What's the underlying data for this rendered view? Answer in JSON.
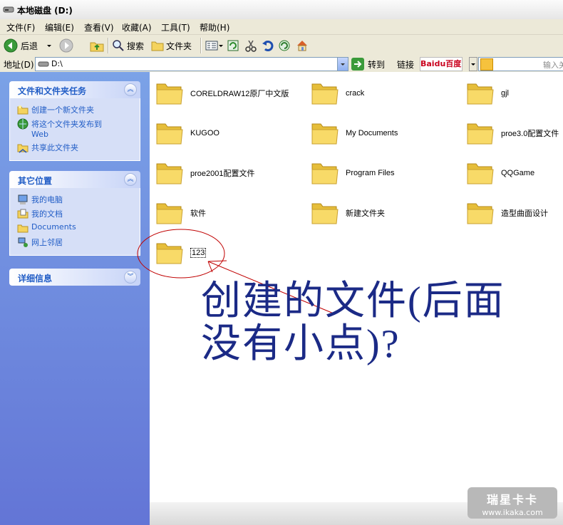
{
  "window": {
    "title": "本地磁盘 (D:)"
  },
  "menu": [
    "文件(F)",
    "编辑(E)",
    "查看(V)",
    "收藏(A)",
    "工具(T)",
    "帮助(H)"
  ],
  "toolbar": {
    "back_label": "后退",
    "search_label": "搜索",
    "folders_label": "文件夹"
  },
  "address": {
    "label": "地址(D)",
    "value": "D:\\",
    "go_label": "转到",
    "links_label": "链接",
    "baidu_label": "Baidu百度",
    "search_placeholder": "输入关"
  },
  "sidebar": {
    "tasks": {
      "title": "文件和文件夹任务",
      "items": [
        "创建一个新文件夹",
        "将这个文件夹发布到 Web",
        "共享此文件夹"
      ]
    },
    "places": {
      "title": "其它位置",
      "items": [
        "我的电脑",
        "我的文档",
        "Documents",
        "网上邻居"
      ]
    },
    "details": {
      "title": "详细信息"
    }
  },
  "files": [
    "CORELDRAW12原厂中文版",
    "crack",
    "gjl",
    "KUGOO",
    "My Documents",
    "proe3.0配置文件",
    "proe2001配置文件",
    "Program Files",
    "QQGame",
    "软件",
    "新建文件夹",
    "造型曲面设计",
    "123"
  ],
  "annotation": {
    "line1": "创建的文件(后面",
    "line2": "没有小点)?"
  },
  "watermark": {
    "line1": "瑞星卡卡",
    "line2": "www.ikaka.com"
  },
  "colors": {
    "annotation": "#1b2a86",
    "circle": "#c00000",
    "sidebar": "#6f8fe0"
  }
}
